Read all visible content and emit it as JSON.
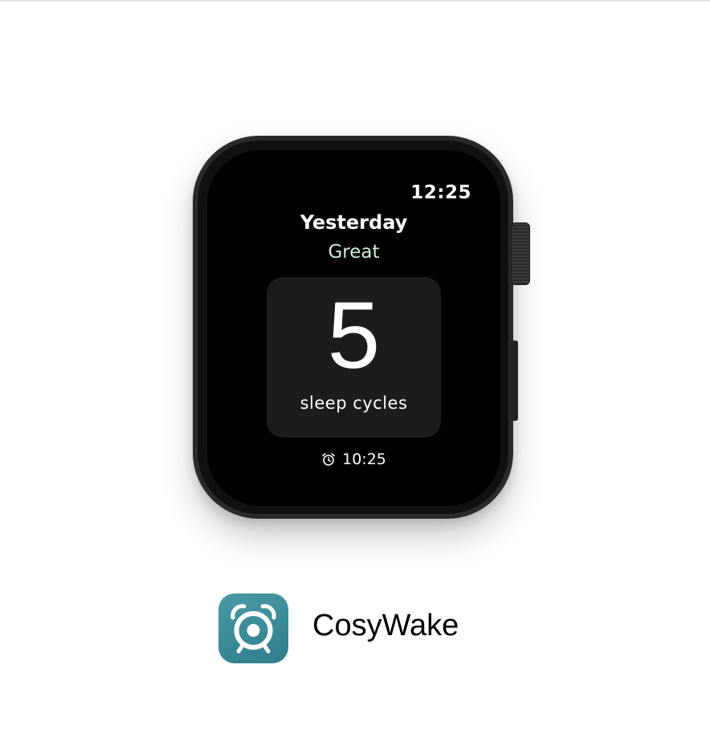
{
  "watch": {
    "time": "12:25",
    "title": "Yesterday",
    "rating": "Great",
    "metric_value": "5",
    "metric_label": "sleep cycles",
    "alarm_time": "10:25"
  },
  "app": {
    "name": "CosyWake",
    "icon": "alarm-clock-icon"
  },
  "colors": {
    "rating": "#cdeed6",
    "icon_bg": "#3a8c99",
    "screen": "#000000",
    "card": "#1c1c1c"
  }
}
